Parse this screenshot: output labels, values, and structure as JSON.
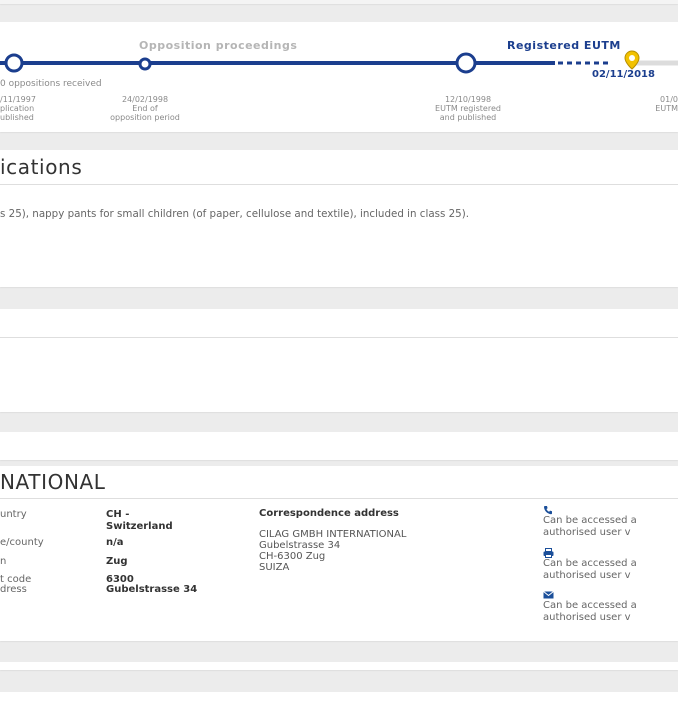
{
  "timeline": {
    "opposition_label": "Opposition proceedings",
    "registered_label": "Registered EUTM",
    "oppositions_received": "0 oppositions received",
    "current_date": "02/11/2018",
    "events": [
      {
        "date": "/11/1997",
        "line1": "plication",
        "line2": "ublished"
      },
      {
        "date": "24/02/1998",
        "line1": "End of",
        "line2": "opposition period"
      },
      {
        "date": "12/10/1998",
        "line1": "EUTM registered",
        "line2": "and published"
      },
      {
        "date": "01/0",
        "line1": "EUTM",
        "line2": ""
      }
    ],
    "colors": {
      "primary": "#1b3e8e",
      "accent": "#f2c200"
    }
  },
  "classifications": {
    "title": "ications",
    "text": "s 25), nappy pants for small children (of paper, cellulose and textile), included in class 25)."
  },
  "owner": {
    "title": "NATIONAL",
    "fields": [
      {
        "label": "untry",
        "value": "CH -",
        "value2": "Switzerland"
      },
      {
        "label": "e/county",
        "value": "n/a"
      },
      {
        "label": "n",
        "value": "Zug"
      },
      {
        "label": "t code",
        "value": "6300"
      },
      {
        "label": "dress",
        "value": "Gubelstrasse 34"
      }
    ],
    "correspondence_title": "Correspondence address",
    "correspondence_lines": [
      "CILAG GMBH INTERNATIONAL",
      "Gubelstrasse 34",
      "CH-6300 Zug",
      "SUIZA"
    ],
    "contacts": [
      {
        "icon": "phone-icon",
        "line1": "Can be accessed a",
        "line2": "authorised user v"
      },
      {
        "icon": "fax-icon",
        "line1": "Can be accessed a",
        "line2": "authorised user v"
      },
      {
        "icon": "email-icon",
        "line1": "Can be accessed a",
        "line2": "authorised user v"
      }
    ]
  }
}
